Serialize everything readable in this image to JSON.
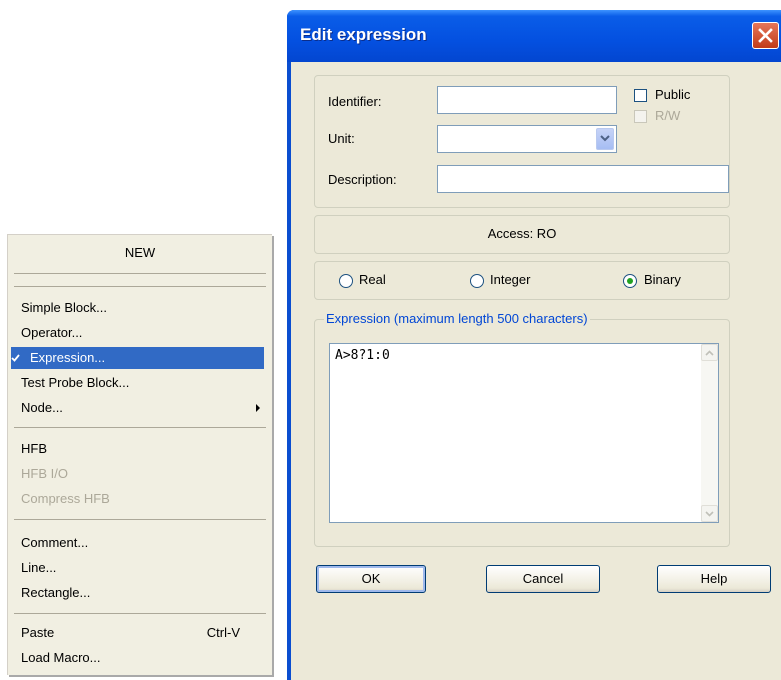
{
  "menu": {
    "header": "NEW",
    "items": [
      {
        "label": "Simple Block...",
        "state": "normal"
      },
      {
        "label": "Operator...",
        "state": "normal"
      },
      {
        "label": "Expression...",
        "state": "selected",
        "checked": true
      },
      {
        "label": "Test Probe Block...",
        "state": "normal"
      },
      {
        "label": "Node...",
        "state": "normal",
        "submenu": true
      },
      {
        "label": "HFB",
        "state": "normal"
      },
      {
        "label": "HFB I/O",
        "state": "disabled"
      },
      {
        "label": "Compress HFB",
        "state": "disabled"
      },
      {
        "label": "Comment...",
        "state": "normal"
      },
      {
        "label": "Line...",
        "state": "normal"
      },
      {
        "label": "Rectangle...",
        "state": "normal"
      },
      {
        "label": "Paste",
        "state": "normal",
        "shortcut": "Ctrl-V"
      },
      {
        "label": "Load Macro...",
        "state": "normal"
      }
    ]
  },
  "dialog": {
    "title": "Edit expression",
    "identifier_label": "Identifier:",
    "identifier_value": "",
    "unit_label": "Unit:",
    "unit_value": "",
    "description_label": "Description:",
    "description_value": "",
    "public_label": "Public",
    "public_checked": false,
    "rw_label": "R/W",
    "rw_checked": false,
    "access_text": "Access: RO",
    "type_options": [
      {
        "label": "Real",
        "selected": false
      },
      {
        "label": "Integer",
        "selected": false
      },
      {
        "label": "Binary",
        "selected": true
      }
    ],
    "expression_legend": "Expression (maximum length 500 characters)",
    "expression_value": "A>8?1:0",
    "buttons": {
      "ok": "OK",
      "cancel": "Cancel",
      "help": "Help"
    }
  },
  "colors": {
    "titlebar": "#0450e0",
    "menu_selection": "#316ac5",
    "dialog_face": "#ece9d8",
    "accent_radio": "#21a121"
  },
  "icons": [
    "check-icon",
    "submenu-arrow-icon",
    "close-icon",
    "dropdown-arrow-icon",
    "scroll-up-icon",
    "scroll-down-icon"
  ]
}
